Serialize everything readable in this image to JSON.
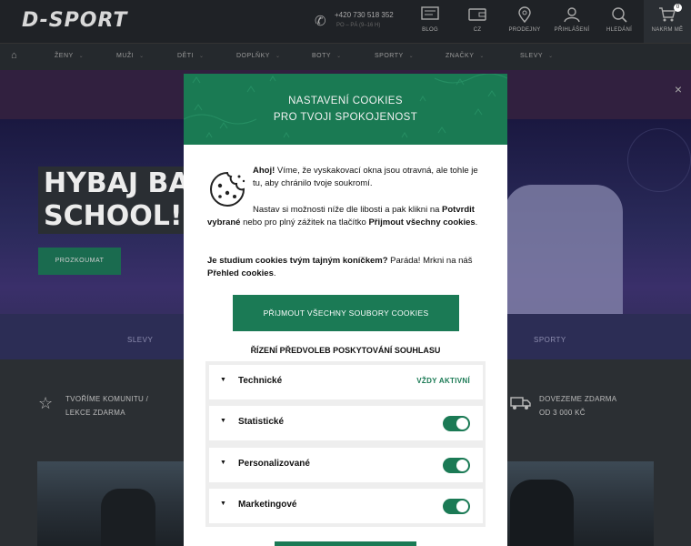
{
  "header": {
    "logo": "D-SPORT",
    "phone_number": "+420 730 518 352",
    "phone_hours": "PO – PÁ (9–16 H)",
    "items": [
      {
        "label": "BLOG",
        "icon": "blog-icon"
      },
      {
        "label": "CZ",
        "icon": "wallet-icon"
      },
      {
        "label": "PRODEJNY",
        "icon": "location-pin-icon"
      },
      {
        "label": "PŘIHLÁŠENÍ",
        "icon": "user-icon"
      },
      {
        "label": "HLEDÁNÍ",
        "icon": "search-icon"
      }
    ],
    "cart": {
      "label": "NAKRM MĚ",
      "count": "0",
      "icon": "cart-icon"
    }
  },
  "nav": {
    "items": [
      "ŽENY",
      "MUŽI",
      "DĚTI",
      "DOPLŇKY",
      "BOTY",
      "SPORTY",
      "ZNAČKY",
      "SLEVY"
    ]
  },
  "banner": {
    "close": "×"
  },
  "hero": {
    "title_line1": "HYBAJ BAC",
    "title_line2": "SCHOOL!",
    "button": "PROZKOUMAT",
    "links": [
      "SLEVY",
      "SPORTY"
    ]
  },
  "features": {
    "left_line1": "TVOŘÍME KOMUNITU /",
    "left_line2": "LEKCE ZDARMA",
    "right_line1": "DOVEZEME ZDARMA",
    "right_line2": "OD 3 000 KČ"
  },
  "modal": {
    "title_line1": "NASTAVENÍ COOKIES",
    "title_line2": "PRO TVOJI SPOKOJENOST",
    "p1_bold": "Ahoj!",
    "p1_rest": " Víme, že vyskakovací okna jsou otravná, ale tohle je tu, aby chránilo tvoje soukromí.",
    "p2_a": "Nastav si možnosti níže dle libosti a pak klikni na ",
    "p2_b": "Potvrdit vybrané",
    "p2_c": " nebo pro plný zážitek na tlačítko ",
    "p2_d": "Přijmout všechny cookies",
    "p2_e": ".",
    "p3_a": "Je studium cookies tvým tajným koníčkem?",
    "p3_b": " Paráda! Mrkni na náš ",
    "p3_c": "Přehled cookies",
    "p3_d": ".",
    "accept_all": "PŘIJMOUT VŠECHNY SOUBORY COOKIES",
    "pref_title": "ŘÍZENÍ PŘEDVOLEB POSKYTOVÁNÍ SOUHLASU",
    "prefs": [
      {
        "label": "Technické",
        "status": "VŽDY AKTIVNÍ"
      },
      {
        "label": "Statistické",
        "enabled": true
      },
      {
        "label": "Personalizované",
        "enabled": true
      },
      {
        "label": "Marketingové",
        "enabled": true
      }
    ]
  }
}
